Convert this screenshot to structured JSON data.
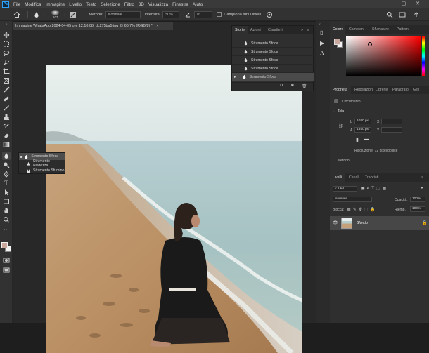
{
  "app": {
    "logo": "Ps"
  },
  "menu": [
    "File",
    "Modifica",
    "Immagine",
    "Livello",
    "Testo",
    "Selezione",
    "Filtro",
    "3D",
    "Visualizza",
    "Finestra",
    "Aiuto"
  ],
  "window_controls": [
    "—",
    "▢",
    "✕"
  ],
  "options": {
    "brush_size": "107",
    "mode_label": "Metodo:",
    "mode_value": "Normale",
    "strength_label": "Intensità:",
    "strength_value": "50%",
    "angle_value": "0°",
    "sample_all": "Campiona tutti i livelli"
  },
  "document_tab": {
    "title": "Immagine WhatsApp 2024-04-05 ore 12.10.08_dc275ba5.jpg @ 66,7% (RGB/8) *",
    "close": "×"
  },
  "history_panel": {
    "tabs": [
      "Storie",
      "Azioni",
      "Caratteri"
    ],
    "items": [
      "Strumento Sfoca",
      "Strumento Sfoca",
      "Strumento Sfoca",
      "Strumento Sfoca",
      "Strumento Sfoca"
    ]
  },
  "flyout": [
    "Strumento Sfoca",
    "Strumento Nitidezza",
    "Strumento Sfumino"
  ],
  "color_panel": {
    "tabs": [
      "Colore",
      "Campioni",
      "Sfumature",
      "Pattern"
    ],
    "accent": "#c9b6ac"
  },
  "properties_panel": {
    "tabs": [
      "Proprietà",
      "Regolazioni",
      "Librerie",
      "Paragrafo",
      "Glifi"
    ],
    "doc_label": "Documento",
    "section": "Tela",
    "w_label": "L",
    "w_value": "1080 px",
    "h_label": "A",
    "h_value": "1350 px",
    "x_label": "X",
    "y_label": "Y",
    "resolution": "Risoluzione: 72 pixel/pollice",
    "metodo": "Metodo"
  },
  "layers_panel": {
    "tabs": [
      "Livelli",
      "Canali",
      "Tracciati"
    ],
    "filter_placeholder": "Tipo",
    "blend": "Normale",
    "opacity_label": "Opacità:",
    "opacity_value": "100%",
    "lock_label": "Blocca:",
    "fill_label": "Riemp.:",
    "fill_value": "100%",
    "layer_name": "Sfondo"
  },
  "colors": {
    "foreground": "#caa79d",
    "background": "#f2f2f2",
    "accent": "#2fa3ff"
  }
}
